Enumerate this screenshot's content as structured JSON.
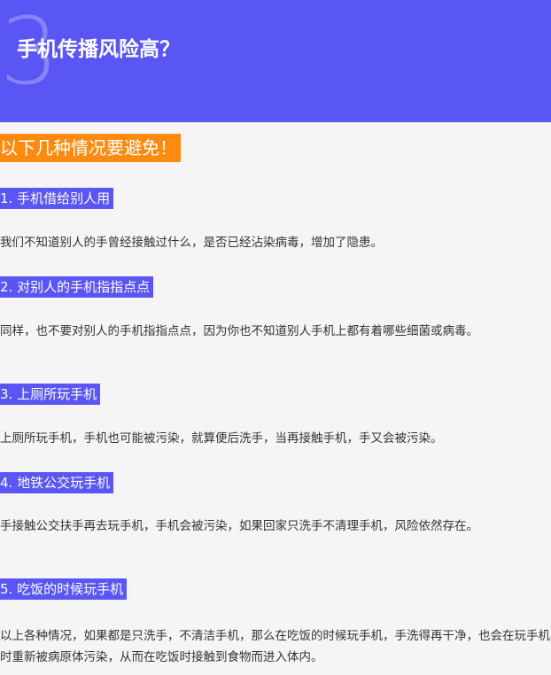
{
  "banner": {
    "number": "3",
    "title": "手机传播风险高？",
    "color": "#5a55f5"
  },
  "section_title": "以下几种情况要避免！",
  "section_color": "#ff8a10",
  "items": [
    {
      "heading": "1. 手机借给别人用",
      "body": "我们不知道别人的手曾经接触过什么，是否已经沾染病毒，增加了隐患。"
    },
    {
      "heading": "2. 对别人的手机指指点点",
      "body": "同样，也不要对别人的手机指指点点，因为你也不知道别人手机上都有着哪些细菌或病毒。"
    },
    {
      "heading": "3. 上厕所玩手机",
      "body": "上厕所玩手机，手机也可能被污染，就算便后洗手，当再接触手机，手又会被污染。"
    },
    {
      "heading": "4. 地铁公交玩手机",
      "body": "手接触公交扶手再去玩手机，手机会被污染，如果回家只洗手不清理手机，风险依然存在。"
    },
    {
      "heading": "5. 吃饭的时候玩手机",
      "body": "以上各种情况，如果都是只洗手，不清洁手机，那么在吃饭的时候玩手机，手洗得再干净，也会在玩手机时重新被病原体污染，从而在吃饭时接触到食物而进入体内。"
    }
  ]
}
